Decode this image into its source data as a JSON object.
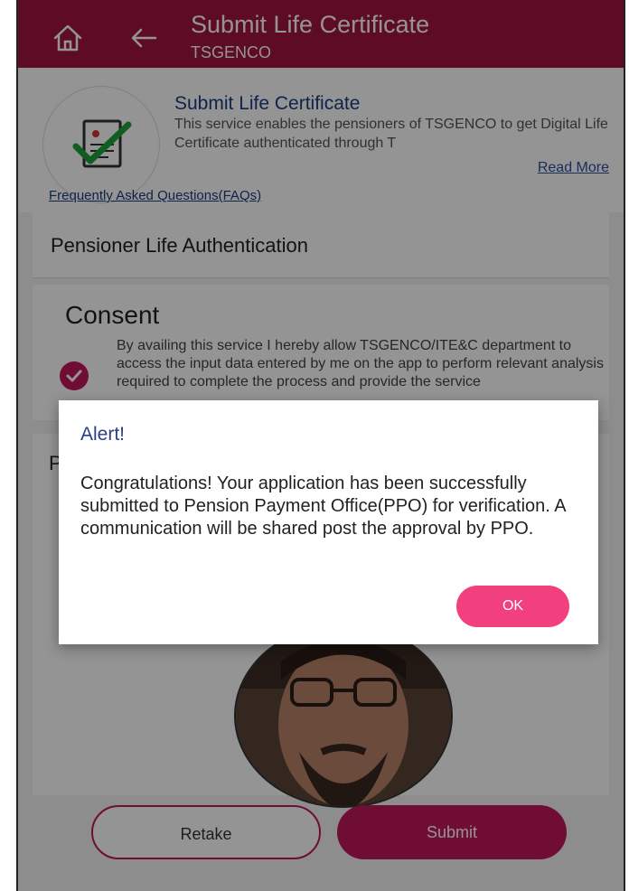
{
  "header": {
    "title": "Submit Life Certificate",
    "subtitle": "TSGENCO"
  },
  "service": {
    "title": "Submit Life Certificate",
    "description": "This service enables the pensioners of TSGENCO to get Digital Life Certificate authenticated through T",
    "read_more": "Read More",
    "faq_link": "Frequently Asked Questions(FAQs)"
  },
  "auth": {
    "title": "Pensioner Life Authentication"
  },
  "consent": {
    "title": "Consent",
    "text": "By availing this service I hereby allow TSGENCO/ITE&C department to access the input data entered by me on the app to perform relevant analysis required to complete the process and provide the service",
    "checked": true
  },
  "photo": {
    "label": "P"
  },
  "buttons": {
    "retake": "Retake",
    "submit": "Submit"
  },
  "alert": {
    "title": "Alert!",
    "message": "Congratulations! Your application has been successfully submitted to Pension Payment Office(PPO) for verification. A communication will be shared post the approval by PPO.",
    "ok": "OK"
  },
  "icons": {
    "home": "home-icon",
    "back": "arrow-left-icon",
    "certificate": "certificate-icon",
    "check": "check-icon"
  },
  "colors": {
    "brand": "#a3143f",
    "accent": "#c2185b",
    "ok_button": "#f23f7d",
    "link": "#1a3d80"
  }
}
